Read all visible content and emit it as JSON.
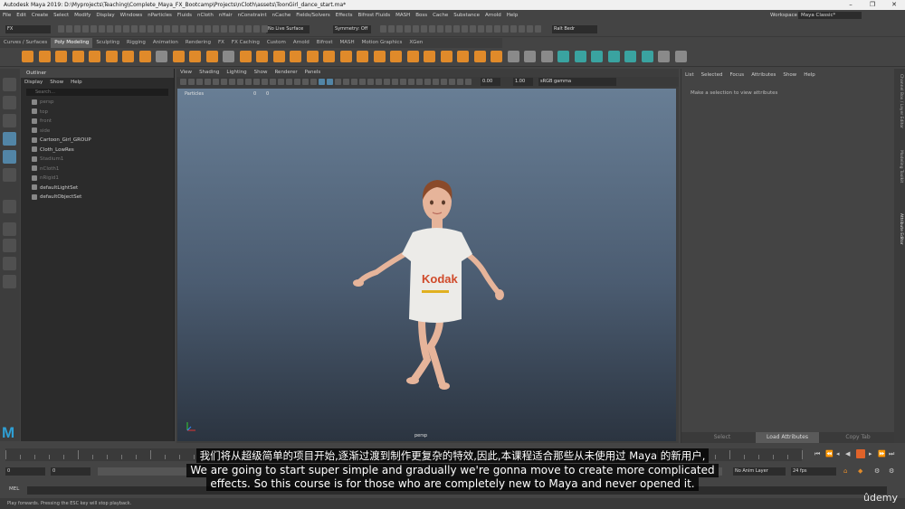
{
  "window": {
    "title": "Autodesk Maya 2019: D:\\Myprojects\\Teaching\\Complete_Maya_FX_Bootcamp\\Projects\\nCloth\\assets\\ToonGirl_dance_start.ma*",
    "controls": [
      "–",
      "❐",
      "✕"
    ]
  },
  "menubar": {
    "items": [
      "File",
      "Edit",
      "Create",
      "Select",
      "Modify",
      "Display",
      "Windows",
      "nParticles",
      "Fluids",
      "nCloth",
      "nHair",
      "nConstraint",
      "nCache",
      "Fields/Solvers",
      "Effects",
      "Bifrost Fluids",
      "MASH",
      "Boss",
      "Cache",
      "Substance",
      "Arnold",
      "Help"
    ],
    "workspace_label": "Workspace :",
    "workspace_value": "Maya Classic*"
  },
  "statusline": {
    "menuset": "FX",
    "live_surface": "No Live Surface",
    "symmetry": "Symmetry: Off",
    "renderer": "Ralt Bedr"
  },
  "shelf": {
    "tabs": [
      "Curves / Surfaces",
      "Poly Modeling",
      "Sculpting",
      "Rigging",
      "Animation",
      "Rendering",
      "FX",
      "FX Caching",
      "Custom",
      "Arnold",
      "Bifrost",
      "MASH",
      "Motion Graphics",
      "XGen"
    ],
    "active_tab": "Poly Modeling"
  },
  "outliner": {
    "title": "Outliner",
    "menu": [
      "Display",
      "Show",
      "Help"
    ],
    "search_placeholder": "Search...",
    "items": [
      {
        "label": "persp",
        "dim": true
      },
      {
        "label": "top",
        "dim": true
      },
      {
        "label": "front",
        "dim": true
      },
      {
        "label": "side",
        "dim": true
      },
      {
        "label": "Cartoon_Girl_GROUP",
        "dim": false
      },
      {
        "label": "Cloth_LowRes",
        "dim": false
      },
      {
        "label": "Stadium1",
        "dim": true
      },
      {
        "label": "nCloth1",
        "dim": true
      },
      {
        "label": "nRigid1",
        "dim": true
      },
      {
        "label": "defaultLightSet",
        "dim": false
      },
      {
        "label": "defaultObjectSet",
        "dim": false
      }
    ]
  },
  "viewport": {
    "menu": [
      "View",
      "Shading",
      "Lighting",
      "Show",
      "Renderer",
      "Panels"
    ],
    "exposure": "0.00",
    "gamma": "1.00",
    "color_space": "sRGB gamma",
    "hud_label": "Particles",
    "hud_values": [
      "0",
      "0"
    ],
    "camera_label": "persp",
    "shirt_logo": "Kodak"
  },
  "attribute_editor": {
    "menu": [
      "List",
      "Selected",
      "Focus",
      "Attributes",
      "Show",
      "Help"
    ],
    "message": "Make a selection to view attributes",
    "buttons": [
      "Select",
      "Load Attributes",
      "Copy Tab"
    ],
    "side_tabs": [
      "Channel Box / Layer Editor",
      "Modeling Toolkit",
      "Attribute Editor"
    ]
  },
  "time": {
    "range_start": "0",
    "range_inner_start": "0",
    "anim_layer": "No Anim Layer",
    "fps": "24 fps",
    "current_frame": "0"
  },
  "cmdline": {
    "label": "MEL"
  },
  "helpline": {
    "text": "Play forwards. Pressing the ESC key will stop playback."
  },
  "subtitles": {
    "chinese": "我们将从超级简单的项目开始,逐渐过渡到制作更复杂的特效,因此,本课程适合那些从未使用过 Maya 的新用户,",
    "english_line1": "We are going to start super simple and gradually we're gonna move to create more complicated",
    "english_line2": "effects. So this course is for those who are completely new to Maya and never opened it."
  },
  "watermark": "ûdemy",
  "colors": {
    "maya_orange": "#e08a2a",
    "selection_blue": "#5285a6",
    "play_button": "#e0632a"
  }
}
